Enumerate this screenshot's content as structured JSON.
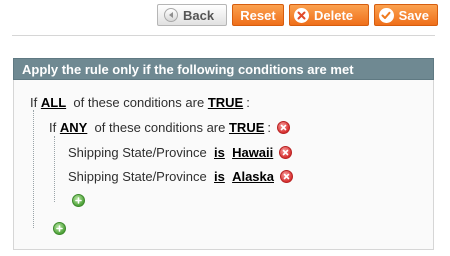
{
  "toolbar": {
    "back_label": "Back",
    "reset_label": "Reset",
    "delete_label": "Delete",
    "save_label": "Save",
    "accent_color": "#f18226"
  },
  "conditions": {
    "header_title": "Apply the rule only if the following conditions are met",
    "root": {
      "prefix": "If",
      "aggregator": "ALL",
      "middle": "of these conditions are",
      "value": "TRUE",
      "suffix": ":"
    },
    "group": {
      "prefix": "If",
      "aggregator": "ANY",
      "middle": "of these conditions are",
      "value": "TRUE",
      "suffix": ":"
    },
    "rules": [
      {
        "attribute": "Shipping State/Province",
        "operator": "is",
        "value": "Hawaii"
      },
      {
        "attribute": "Shipping State/Province",
        "operator": "is",
        "value": "Alaska"
      }
    ],
    "icons": {
      "remove": "remove-icon",
      "add": "add-icon"
    }
  }
}
